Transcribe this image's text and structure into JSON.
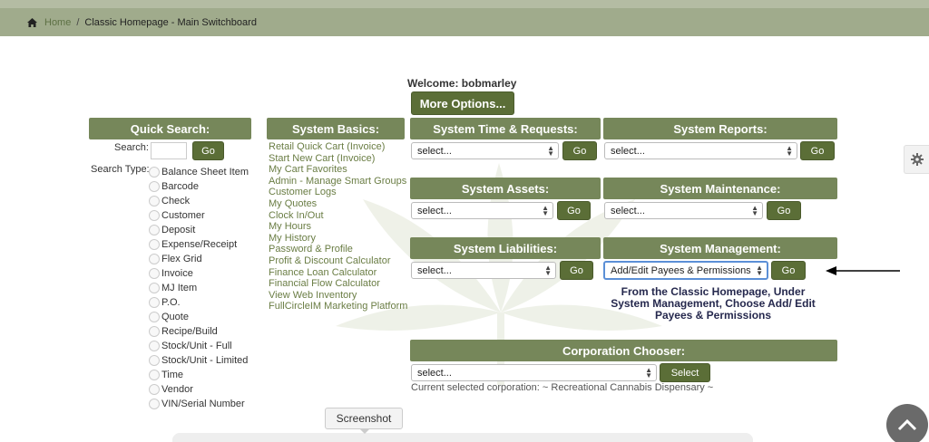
{
  "breadcrumb": {
    "home_label": "Home",
    "separator": "/",
    "current": "Classic Homepage - Main Switchboard"
  },
  "welcome_text": "Welcome: bobmarley",
  "more_options_label": "More Options...",
  "quick_search": {
    "title": "Quick Search:",
    "search_label": "Search:",
    "search_value": "",
    "go_label": "Go",
    "type_label": "Search Type:",
    "types": [
      "Balance Sheet Item",
      "Barcode",
      "Check",
      "Customer",
      "Deposit",
      "Expense/Receipt",
      "Flex Grid",
      "Invoice",
      "MJ Item",
      "P.O.",
      "Quote",
      "Recipe/Build",
      "Stock/Unit - Full",
      "Stock/Unit - Limited",
      "Time",
      "Vendor",
      "VIN/Serial Number"
    ]
  },
  "system_basics": {
    "title": "System Basics:",
    "links": [
      "Retail Quick Cart (Invoice)",
      "Start New Cart (Invoice)",
      "My Cart Favorites",
      "Admin - Manage Smart Groups",
      "Customer Logs",
      "My Quotes",
      "Clock In/Out",
      "My Hours",
      "My History",
      "Password & Profile",
      "Profit & Discount Calculator",
      "Finance Loan Calculator",
      "Financial Flow Calculator",
      "View Web Inventory",
      "FullCircleIM Marketing Platform"
    ]
  },
  "panels": {
    "time_requests": {
      "title": "System Time & Requests:",
      "selected": "select...",
      "go_label": "Go"
    },
    "reports": {
      "title": "System Reports:",
      "selected": "select...",
      "go_label": "Go"
    },
    "assets": {
      "title": "System Assets:",
      "selected": "select...",
      "go_label": "Go"
    },
    "maintenance": {
      "title": "System Maintenance:",
      "selected": "select...",
      "go_label": "Go"
    },
    "liabilities": {
      "title": "System Liabilities:",
      "selected": "select...",
      "go_label": "Go"
    },
    "management": {
      "title": "System Management:",
      "selected": "Add/Edit Payees & Permissions",
      "go_label": "Go"
    }
  },
  "annotation_note": "From the Classic Homepage, Under System Management, Choose Add/ Edit Payees & Permissions",
  "corporation": {
    "title": "Corporation Chooser:",
    "selected": "select...",
    "select_label": "Select",
    "status": "Current selected corporation: ~ Recreational Cannabis Dispensary ~"
  },
  "screenshot_tip": "Screenshot",
  "colors": {
    "header_green": "#76875a",
    "button_green": "#5b6e37",
    "link_green": "#6a7d44",
    "note_navy": "#25284d"
  },
  "icons": [
    "home-icon",
    "gear-icon",
    "chevron-up-icon",
    "arrow-left-icon"
  ]
}
